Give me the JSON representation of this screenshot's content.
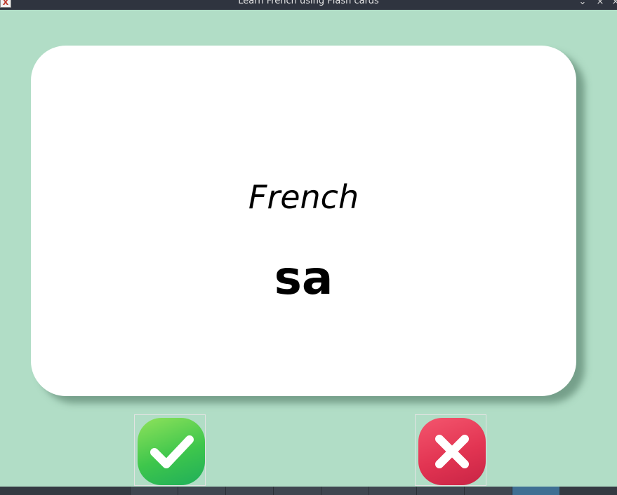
{
  "window": {
    "title": "Learn French using Flash cards",
    "controls": {
      "minimize_icon": "chevron-down-icon",
      "close_icon": "close-icon"
    }
  },
  "card": {
    "language": "French",
    "word": "sa"
  },
  "buttons": {
    "right": {
      "icon": "checkmark-icon",
      "color": "#3ec64c"
    },
    "wrong": {
      "icon": "cross-icon",
      "color": "#e23452"
    }
  },
  "colors": {
    "background": "#b1ddc6",
    "card": "#ffffff",
    "titlebar": "#2f343f",
    "taskbar": "#343a42"
  },
  "glyphs": {
    "min": "⌄",
    "close": "×",
    "extra": "×",
    "app": "X"
  }
}
